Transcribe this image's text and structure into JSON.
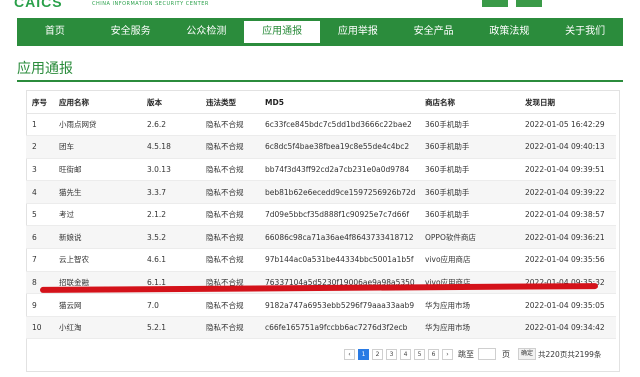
{
  "header": {
    "logo_text": "CAICS",
    "logo_subtitle": "CHINA INFORMATION SECURITY CENTER"
  },
  "nav": {
    "items": [
      "首页",
      "安全服务",
      "公众检测",
      "应用通报",
      "应用举报",
      "安全产品",
      "政策法规",
      "关于我们"
    ],
    "active_index": 3
  },
  "page_title": "应用通报",
  "table": {
    "headers": [
      "序号",
      "应用名称",
      "版本",
      "违法类型",
      "MD5",
      "商店名称",
      "发现日期"
    ],
    "rows": [
      [
        "1",
        "小雨点网贷",
        "2.6.2",
        "隐私不合规",
        "6c33fce845bdc7c5dd1bd3666c22bae2",
        "360手机助手",
        "2022-01-05 16:42:29"
      ],
      [
        "2",
        "团车",
        "4.5.18",
        "隐私不合规",
        "6c8dc5f4bae38fbea19c8e55de4c4bc2",
        "360手机助手",
        "2022-01-04 09:40:13"
      ],
      [
        "3",
        "旺街邮",
        "3.0.13",
        "隐私不合规",
        "bb74f3d43ff92cd2a7cb231e0a0d9784",
        "360手机助手",
        "2022-01-04 09:39:51"
      ],
      [
        "4",
        "猫先生",
        "3.3.7",
        "隐私不合规",
        "beb81b62e6ecedd9ce1597256926b72d",
        "360手机助手",
        "2022-01-04 09:39:22"
      ],
      [
        "5",
        "考过",
        "2.1.2",
        "隐私不合规",
        "7d09e5bbcf35d888f1c90925e7c7d66f",
        "360手机助手",
        "2022-01-04 09:38:57"
      ],
      [
        "6",
        "新娘说",
        "3.5.2",
        "隐私不合规",
        "66086c98ca71a36ae4f8643733418712",
        "OPPO软件商店",
        "2022-01-04 09:36:21"
      ],
      [
        "7",
        "云上智农",
        "4.6.1",
        "隐私不合规",
        "97b144ac0a531be44334bbc5001a1b5f",
        "vivo应用商店",
        "2022-01-04 09:35:56"
      ],
      [
        "8",
        "招联金融",
        "6.1.1",
        "隐私不合规",
        "76337104a5d5230f19006ae9a98a5350",
        "vivo应用商店",
        "2022-01-04 09:35:32"
      ],
      [
        "9",
        "猫云网",
        "7.0",
        "隐私不合规",
        "9182a747a6953ebb5296f79aaa33aab9",
        "华为应用市场",
        "2022-01-04 09:35:05"
      ],
      [
        "10",
        "小红淘",
        "5.2.1",
        "隐私不合规",
        "c66fe165751a9fccbb6ac7276d3f2ecb",
        "华为应用市场",
        "2022-01-04 09:34:42"
      ]
    ]
  },
  "highlight": {
    "row_number": "8",
    "color": "#d4121a"
  },
  "pagination": {
    "prev": "‹",
    "pages": [
      "1",
      "2",
      "3",
      "4",
      "5",
      "6"
    ],
    "current": "1",
    "next": "›",
    "jump_label": "跳至",
    "jump_value": "",
    "page_unit": "页",
    "ok_label": "确定",
    "total_text": "共220页共2199条"
  },
  "colors": {
    "brand_green": "#2b8c3c",
    "active_page_blue": "#2a7be4"
  }
}
